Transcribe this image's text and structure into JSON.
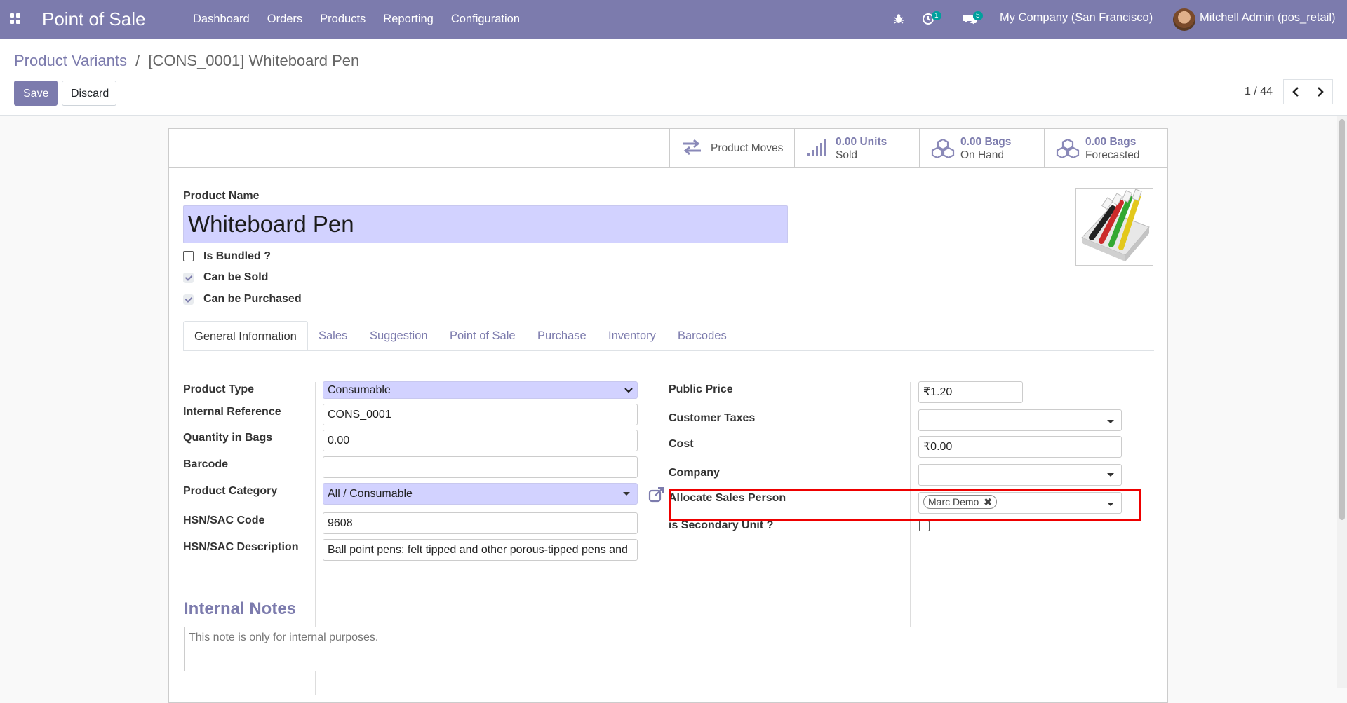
{
  "navbar": {
    "brand": "Point of Sale",
    "menu": [
      "Dashboard",
      "Orders",
      "Products",
      "Reporting",
      "Configuration"
    ],
    "activity_count": "1",
    "message_count": "5",
    "company": "My Company (San Francisco)",
    "user": "Mitchell Admin (pos_retail)"
  },
  "breadcrumb": {
    "parent": "Product Variants",
    "separator": "/",
    "current": "[CONS_0001] Whiteboard Pen"
  },
  "actions": {
    "save": "Save",
    "discard": "Discard"
  },
  "pager": {
    "value": "1 / 44"
  },
  "stat_buttons": [
    {
      "icon": "arrows-exchange-icon",
      "label": "Product Moves"
    },
    {
      "icon": "signal-bars-icon",
      "value": "0.00 Units",
      "label": "Sold"
    },
    {
      "icon": "cubes-icon",
      "value": "0.00 Bags",
      "label": "On Hand"
    },
    {
      "icon": "cubes-icon",
      "value": "0.00 Bags",
      "label": "Forecasted"
    }
  ],
  "product": {
    "name_label": "Product Name",
    "name": "Whiteboard Pen",
    "checkboxes": [
      {
        "label": "Is Bundled ?",
        "checked": false
      },
      {
        "label": "Can be Sold",
        "checked": true
      },
      {
        "label": "Can be Purchased",
        "checked": true
      }
    ]
  },
  "tabs": [
    "General Information",
    "Sales",
    "Suggestion",
    "Point of Sale",
    "Purchase",
    "Inventory",
    "Barcodes"
  ],
  "left_fields": [
    {
      "label": "Product Type",
      "value": "Consumable"
    },
    {
      "label": "Internal Reference",
      "value": "CONS_0001"
    },
    {
      "label": "Quantity in Bags",
      "value": "0.00"
    },
    {
      "label": "Barcode",
      "value": ""
    },
    {
      "label": "Product Category",
      "value": "All / Consumable"
    },
    {
      "label": "HSN/SAC Code",
      "value": "9608"
    },
    {
      "label": "HSN/SAC Description",
      "value": "Ball point pens; felt tipped and other porous-tipped pens and"
    }
  ],
  "right_fields": [
    {
      "label": "Public Price",
      "value": "₹1.20"
    },
    {
      "label": "Customer Taxes",
      "value": ""
    },
    {
      "label": "Cost",
      "value": "₹0.00"
    },
    {
      "label": "Company",
      "value": ""
    },
    {
      "label": "Allocate Sales Person",
      "tag": "Marc Demo"
    },
    {
      "label": "is Secondary Unit ?",
      "checked": false
    }
  ],
  "notes": {
    "title": "Internal Notes",
    "placeholder": "This note is only for internal purposes."
  },
  "colors": {
    "brand": "#7c7bad",
    "required": "#d2d2ff",
    "highlight": "#e00000",
    "badge": "#00a09d"
  }
}
